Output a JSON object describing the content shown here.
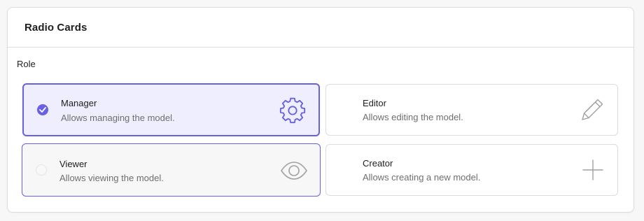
{
  "panel": {
    "title": "Radio Cards"
  },
  "field": {
    "label": "Role"
  },
  "options": [
    {
      "title": "Manager",
      "description": "Allows managing the model.",
      "icon": "gear-icon",
      "checked": true
    },
    {
      "title": "Editor",
      "description": "Allows editing the model.",
      "icon": "pencil-icon",
      "checked": false
    },
    {
      "title": "Viewer",
      "description": "Allows viewing the model.",
      "icon": "eye-icon",
      "checked": false
    },
    {
      "title": "Creator",
      "description": "Allows creating a new model.",
      "icon": "plus-icon",
      "checked": false
    }
  ],
  "colors": {
    "accent": "#6760e0",
    "checked_bg": "#eeeeff",
    "icon_gray": "#a0a0a0"
  }
}
